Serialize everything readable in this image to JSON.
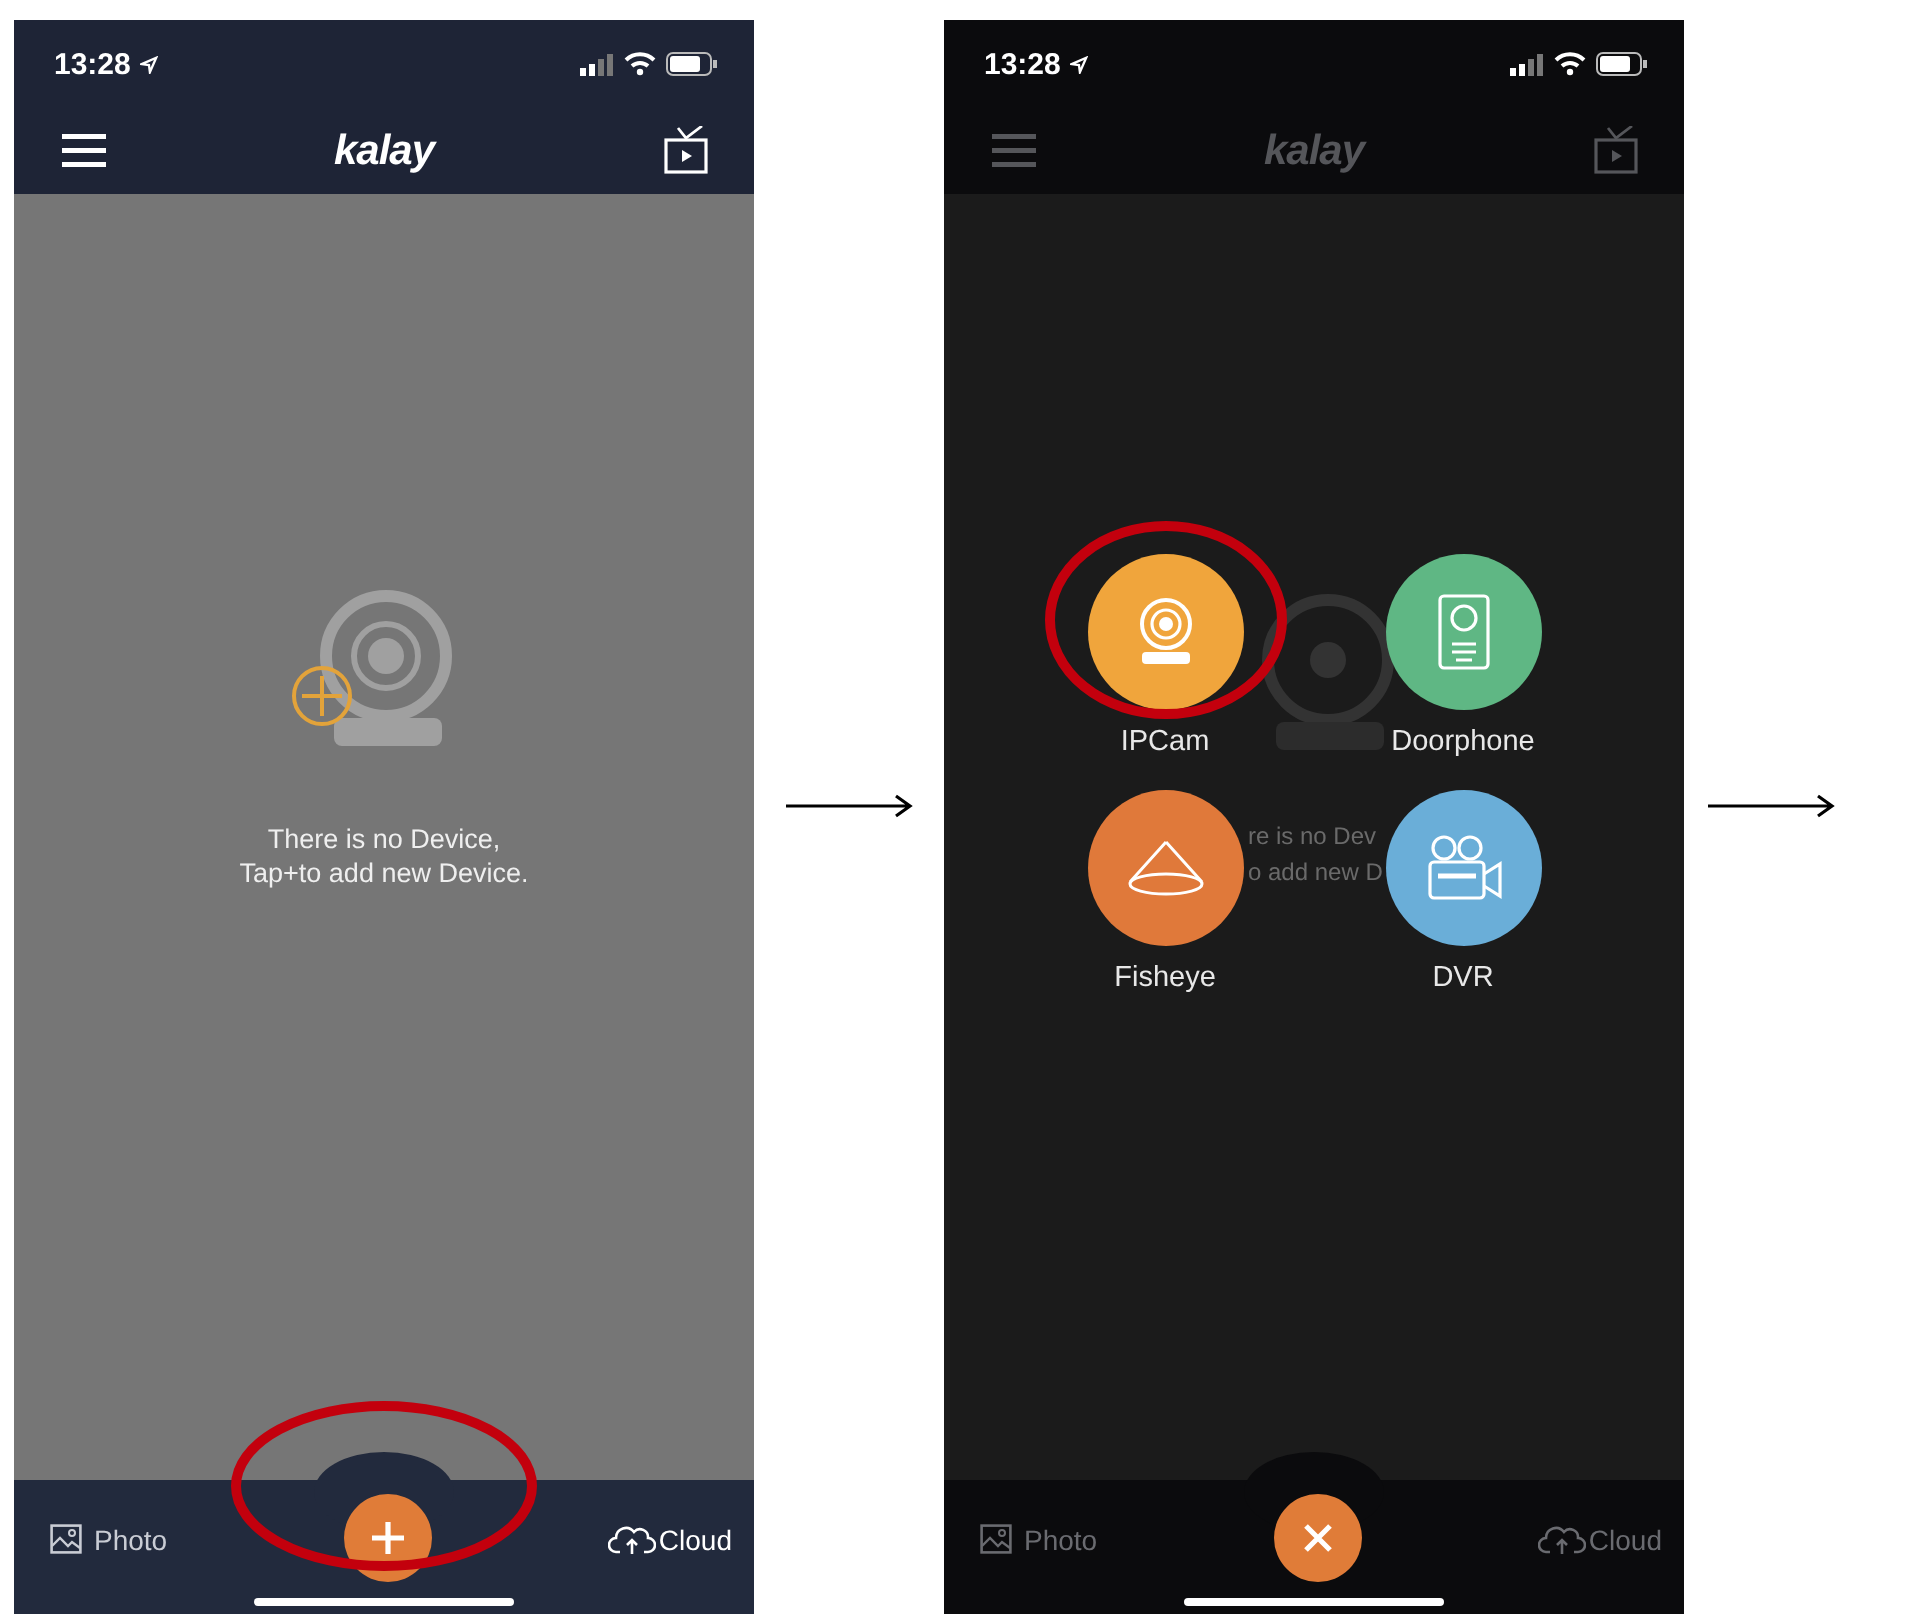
{
  "screens": [
    {
      "kind": "home",
      "status_bar": {
        "time": "13:28"
      },
      "header": {
        "logo": "kalay",
        "dimmed": false
      },
      "empty_state": {
        "lines": [
          "There is no Device,",
          "Tap+to add new Device."
        ]
      },
      "tab_bar": {
        "left": "Photo",
        "right": "Cloud",
        "dimmed": false,
        "center_button": {
          "kind": "add",
          "highlighted": true
        }
      }
    },
    {
      "kind": "add_menu",
      "status_bar": {
        "time": "13:28"
      },
      "header": {
        "logo": "kalay",
        "dimmed": true
      },
      "empty_state": {
        "lines": [
          "re is no Dev",
          "o add new D"
        ]
      },
      "menu": [
        {
          "label": "IPCam",
          "color": "#f0a53c",
          "kind": "webcam",
          "highlighted": true
        },
        {
          "label": "Doorphone",
          "color": "#5fb784",
          "kind": "doorphone",
          "highlighted": false
        },
        {
          "label": "Fisheye",
          "color": "#e0793a",
          "kind": "fisheye",
          "highlighted": false
        },
        {
          "label": "DVR",
          "color": "#6aaed8",
          "kind": "dvr",
          "highlighted": false
        }
      ],
      "tab_bar": {
        "left": "Photo",
        "right": "Cloud",
        "dimmed": true,
        "center_button": {
          "kind": "close",
          "highlighted": false
        }
      }
    }
  ]
}
